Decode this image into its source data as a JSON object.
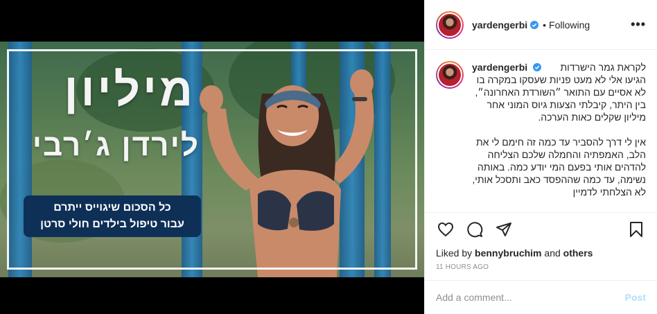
{
  "media": {
    "headline": "מיליון",
    "subhead": "לירדן ג׳רבי",
    "banner_line1": "כל הסכום שיגוייס ייתרם",
    "banner_line2": "עבור טיפול בילדים חולי סרטן"
  },
  "header": {
    "username": "yardengerbi",
    "separator": "•",
    "follow_label": "Following",
    "more_icon": "more-horizontal-icon"
  },
  "caption": {
    "username": "yardengerbi",
    "first_line": "לקראת גמר הישרדות",
    "paragraph1": "הגיעו אלי לא מעט פניות שעסקו במקרה בו לא אסיים עם התואר ״השורדת האחרונה״, בין היתר, קיבלתי הצעות גיוס המוני אחר מיליון שקלים כאות הערכה.",
    "paragraph2": "אין לי דרך להסביר עד כמה זה חימם לי את הלב, האמפתיה והחמלה שלכם הצליחה להדהים אותי בפעם המי יודע כמה. באותה נשימה, עד כמה שההפסד כאב ותסכל אותי, לא הצלחתי לדמיין"
  },
  "actions": {
    "like_icon": "heart-icon",
    "comment_icon": "comment-icon",
    "share_icon": "share-icon",
    "save_icon": "bookmark-icon"
  },
  "likes": {
    "prefix": "Liked by",
    "user": "bennybruchim",
    "joiner": "and",
    "others": "others"
  },
  "timestamp": "11 HOURS AGO",
  "comment": {
    "placeholder": "Add a comment...",
    "post_label": "Post"
  },
  "colors": {
    "verified": "#3897f0",
    "banner": "#0e3057",
    "post_disabled": "#b2dffc"
  }
}
